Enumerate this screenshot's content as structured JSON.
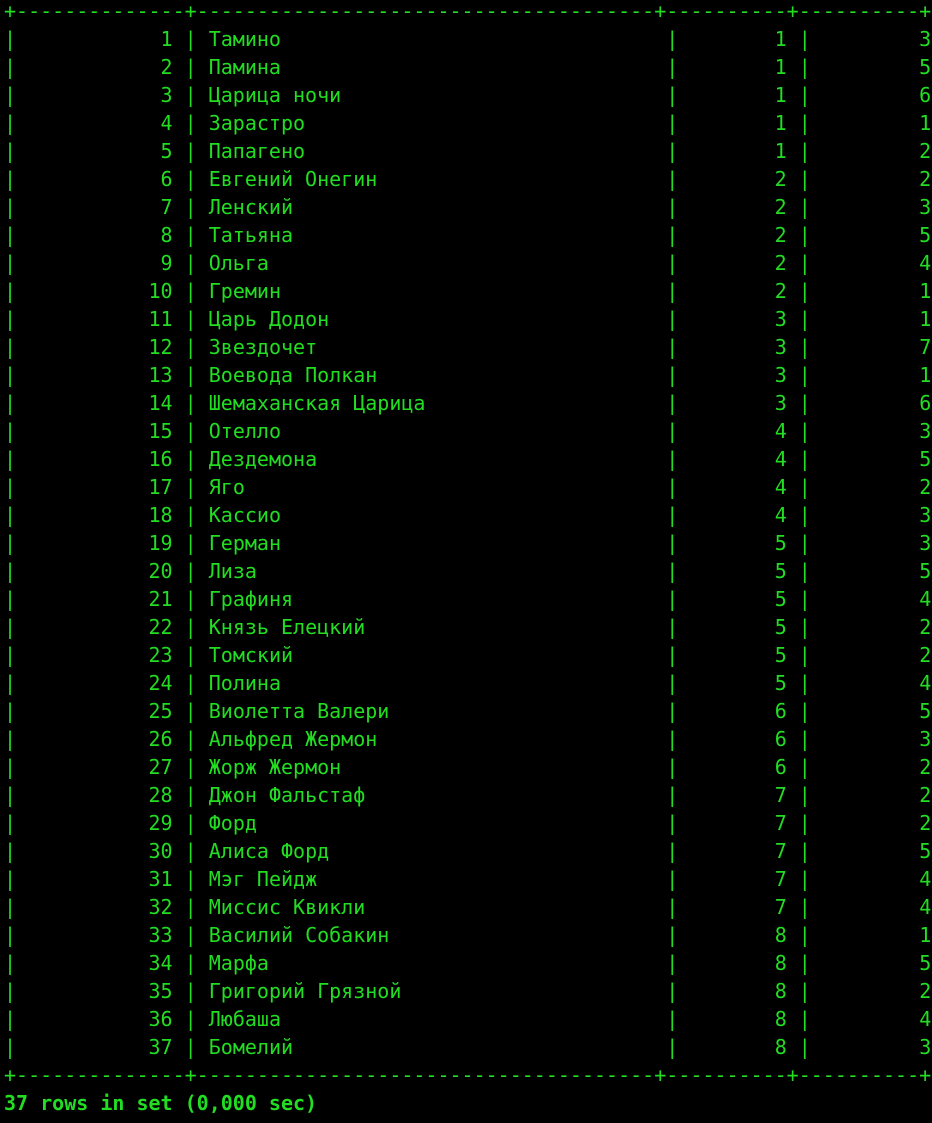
{
  "terminal": {
    "fg_color": "#22dd22",
    "bg_color": "#000000",
    "border": "+--------------+--------------------------------------+----------+----------+",
    "status": "37 rows in set (0,000 sec)"
  },
  "rows": [
    {
      "id": "1",
      "name": "Тамино",
      "c3": "1",
      "c4": "3"
    },
    {
      "id": "2",
      "name": "Памина",
      "c3": "1",
      "c4": "5"
    },
    {
      "id": "3",
      "name": "Царица ночи",
      "c3": "1",
      "c4": "6"
    },
    {
      "id": "4",
      "name": "Зарастро",
      "c3": "1",
      "c4": "1"
    },
    {
      "id": "5",
      "name": "Папагено",
      "c3": "1",
      "c4": "2"
    },
    {
      "id": "6",
      "name": "Евгений Онегин",
      "c3": "2",
      "c4": "2"
    },
    {
      "id": "7",
      "name": "Ленский",
      "c3": "2",
      "c4": "3"
    },
    {
      "id": "8",
      "name": "Татьяна",
      "c3": "2",
      "c4": "5"
    },
    {
      "id": "9",
      "name": "Ольга",
      "c3": "2",
      "c4": "4"
    },
    {
      "id": "10",
      "name": "Гремин",
      "c3": "2",
      "c4": "1"
    },
    {
      "id": "11",
      "name": "Царь Додон",
      "c3": "3",
      "c4": "1"
    },
    {
      "id": "12",
      "name": "Звездочет",
      "c3": "3",
      "c4": "7"
    },
    {
      "id": "13",
      "name": "Воевода Полкан",
      "c3": "3",
      "c4": "1"
    },
    {
      "id": "14",
      "name": "Шемаханская Царица",
      "c3": "3",
      "c4": "6"
    },
    {
      "id": "15",
      "name": "Отелло",
      "c3": "4",
      "c4": "3"
    },
    {
      "id": "16",
      "name": "Дездемона",
      "c3": "4",
      "c4": "5"
    },
    {
      "id": "17",
      "name": "Яго",
      "c3": "4",
      "c4": "2"
    },
    {
      "id": "18",
      "name": "Кассио",
      "c3": "4",
      "c4": "3"
    },
    {
      "id": "19",
      "name": "Герман",
      "c3": "5",
      "c4": "3"
    },
    {
      "id": "20",
      "name": "Лиза",
      "c3": "5",
      "c4": "5"
    },
    {
      "id": "21",
      "name": "Графиня",
      "c3": "5",
      "c4": "4"
    },
    {
      "id": "22",
      "name": "Князь Елецкий",
      "c3": "5",
      "c4": "2"
    },
    {
      "id": "23",
      "name": "Томский",
      "c3": "5",
      "c4": "2"
    },
    {
      "id": "24",
      "name": "Полина",
      "c3": "5",
      "c4": "4"
    },
    {
      "id": "25",
      "name": "Виолетта Валери",
      "c3": "6",
      "c4": "5"
    },
    {
      "id": "26",
      "name": "Альфред Жермон",
      "c3": "6",
      "c4": "3"
    },
    {
      "id": "27",
      "name": "Жорж Жермон",
      "c3": "6",
      "c4": "2"
    },
    {
      "id": "28",
      "name": "Джон Фальстаф",
      "c3": "7",
      "c4": "2"
    },
    {
      "id": "29",
      "name": "Форд",
      "c3": "7",
      "c4": "2"
    },
    {
      "id": "30",
      "name": "Алиса Форд",
      "c3": "7",
      "c4": "5"
    },
    {
      "id": "31",
      "name": "Мэг Пейдж",
      "c3": "7",
      "c4": "4"
    },
    {
      "id": "32",
      "name": "Миссис Квикли",
      "c3": "7",
      "c4": "4"
    },
    {
      "id": "33",
      "name": "Василий Собакин",
      "c3": "8",
      "c4": "1"
    },
    {
      "id": "34",
      "name": "Марфа",
      "c3": "8",
      "c4": "5"
    },
    {
      "id": "35",
      "name": "Григорий Грязной",
      "c3": "8",
      "c4": "2"
    },
    {
      "id": "36",
      "name": "Любаша",
      "c3": "8",
      "c4": "4"
    },
    {
      "id": "37",
      "name": "Бомелий",
      "c3": "8",
      "c4": "3"
    }
  ]
}
